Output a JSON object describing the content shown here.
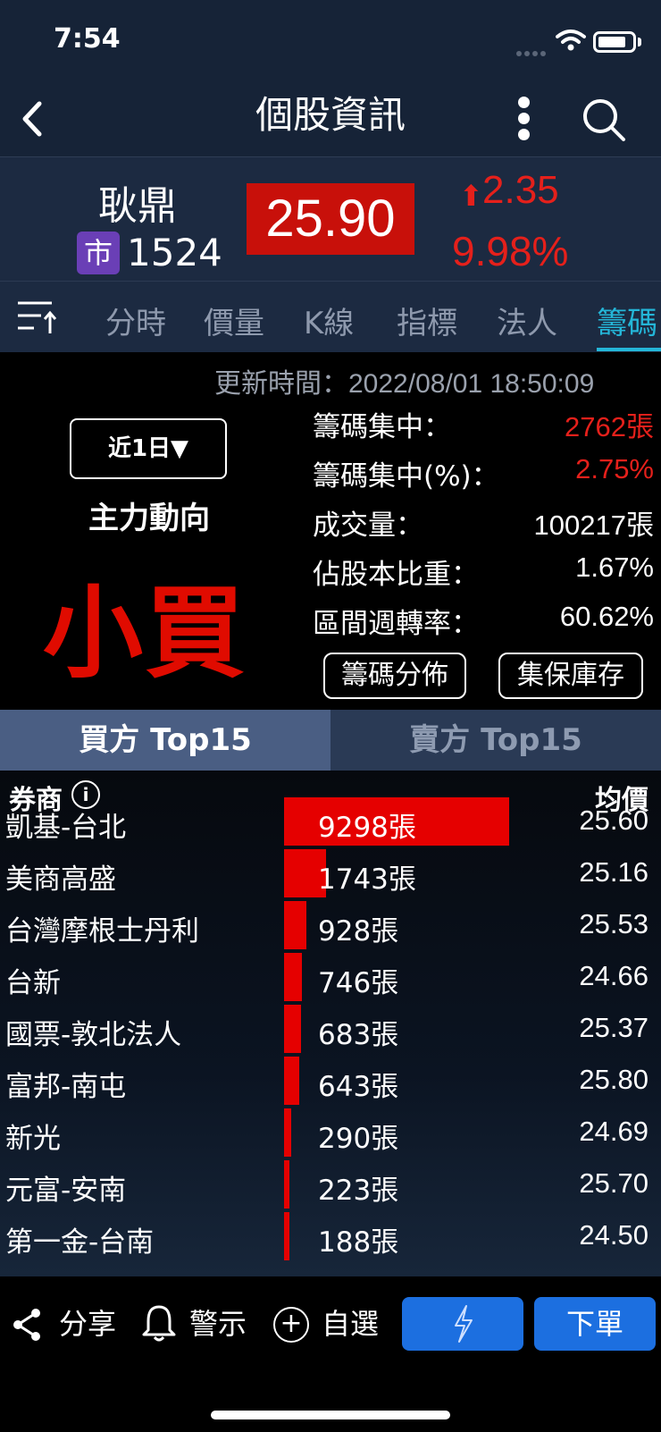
{
  "status": {
    "time": "7:54"
  },
  "header": {
    "title": "個股資訊"
  },
  "stock": {
    "name": "耿鼎",
    "market_badge": "市",
    "code": "1524",
    "price": "25.90",
    "change": "2.35",
    "change_pct": "9.98%",
    "colors": {
      "up": "#e5201b",
      "price_bg": "#c8100a"
    }
  },
  "tabs": [
    {
      "label": "分時"
    },
    {
      "label": "價量"
    },
    {
      "label": "K線"
    },
    {
      "label": "指標"
    },
    {
      "label": "法人"
    },
    {
      "label": "籌碼",
      "active": true
    }
  ],
  "chip": {
    "update_time": "更新時間：2022/08/01 18:50:09",
    "period": "近1日▼",
    "trend_label": "主力動向",
    "trend_value": "小買",
    "stats": [
      {
        "label": "籌碼集中：",
        "value": "2762張",
        "highlight": true
      },
      {
        "label": "籌碼集中(%)：",
        "value": "2.75%",
        "highlight": true
      },
      {
        "label": "成交量：",
        "value": "100217張",
        "highlight": false
      },
      {
        "label": "佔股本比重：",
        "value": "1.67%",
        "highlight": false
      },
      {
        "label": "區間週轉率：",
        "value": "60.62%",
        "highlight": false
      }
    ],
    "buttons": {
      "distribution": "籌碼分佈",
      "custody": "集保庫存"
    }
  },
  "side_tabs": {
    "buy": "買方 Top15",
    "sell": "賣方 Top15"
  },
  "table": {
    "col_broker": "券商",
    "col_avg": "均價",
    "rows": [
      {
        "broker": "凱基-台北",
        "qty": "9298張",
        "qty_value": 9298,
        "avg": "25.60"
      },
      {
        "broker": "美商高盛",
        "qty": "1743張",
        "qty_value": 1743,
        "avg": "25.16"
      },
      {
        "broker": "台灣摩根士丹利",
        "qty": "928張",
        "qty_value": 928,
        "avg": "25.53"
      },
      {
        "broker": "台新",
        "qty": "746張",
        "qty_value": 746,
        "avg": "24.66"
      },
      {
        "broker": "國票-敦北法人",
        "qty": "683張",
        "qty_value": 683,
        "avg": "25.37"
      },
      {
        "broker": "富邦-南屯",
        "qty": "643張",
        "qty_value": 643,
        "avg": "25.80"
      },
      {
        "broker": "新光",
        "qty": "290張",
        "qty_value": 290,
        "avg": "24.69"
      },
      {
        "broker": "元富-安南",
        "qty": "223張",
        "qty_value": 223,
        "avg": "25.70"
      },
      {
        "broker": "第一金-台南",
        "qty": "188張",
        "qty_value": 188,
        "avg": "24.50"
      }
    ]
  },
  "toolbar": {
    "share": "分享",
    "alert": "警示",
    "watchlist": "自選",
    "order": "下單",
    "button_color": "#1c6fe0"
  },
  "icons": {
    "back": "chevron-left-icon",
    "more": "more-vertical-icon",
    "search": "search-icon",
    "menu": "sort-menu-icon",
    "info": "info-icon",
    "share": "share-icon",
    "bell": "bell-icon",
    "add": "plus-circle-icon",
    "flash": "lightning-icon"
  }
}
